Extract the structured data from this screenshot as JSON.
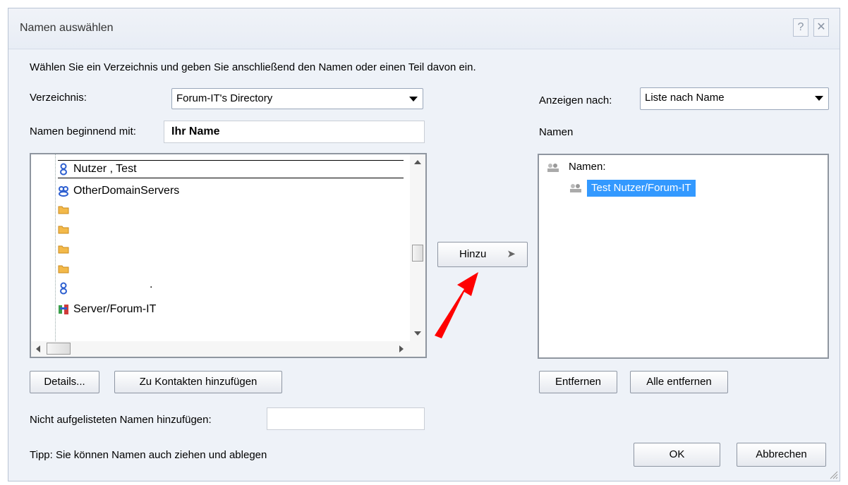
{
  "window": {
    "title": "Namen auswählen",
    "help_label": "?",
    "close_label": "✕"
  },
  "instruction": "Wählen Sie ein Verzeichnis und geben Sie anschließend den Namen oder einen Teil davon ein.",
  "directory": {
    "label": "Verzeichnis:",
    "value": "Forum-IT's Directory"
  },
  "name_search": {
    "label": "Namen beginnend mit:",
    "value": "Ihr Name"
  },
  "tree_items": [
    {
      "icon": "person-icon",
      "label": "Nutzer , Test"
    },
    {
      "icon": "group-icon",
      "label": "OtherDomainServers"
    },
    {
      "icon": "folder-icon",
      "label": ""
    },
    {
      "icon": "folder-icon",
      "label": ""
    },
    {
      "icon": "folder-icon",
      "label": ""
    },
    {
      "icon": "folder-icon",
      "label": ""
    },
    {
      "icon": "person-icon",
      "label": "."
    },
    {
      "icon": "server-icon",
      "label": "Server/Forum-IT"
    }
  ],
  "add_button": {
    "label": "Hinzu",
    "arrow": "➤"
  },
  "display": {
    "label": "Anzeigen nach:",
    "value": "Liste nach Name"
  },
  "names_panel": {
    "label": "Namen",
    "root": "Namen:",
    "selected": "Test Nutzer/Forum-IT"
  },
  "buttons": {
    "details": "Details...",
    "add_contacts": "Zu Kontakten hinzufügen",
    "remove": "Entfernen",
    "remove_all": "Alle entfernen",
    "ok": "OK",
    "cancel": "Abbrechen"
  },
  "unlisted": {
    "label": "Nicht aufgelisteten Namen hinzufügen:",
    "value": ""
  },
  "tip": "Tipp: Sie können Namen auch ziehen und ablegen",
  "colors": {
    "selection": "#3399ff",
    "annotation_arrow": "#ff0000"
  }
}
